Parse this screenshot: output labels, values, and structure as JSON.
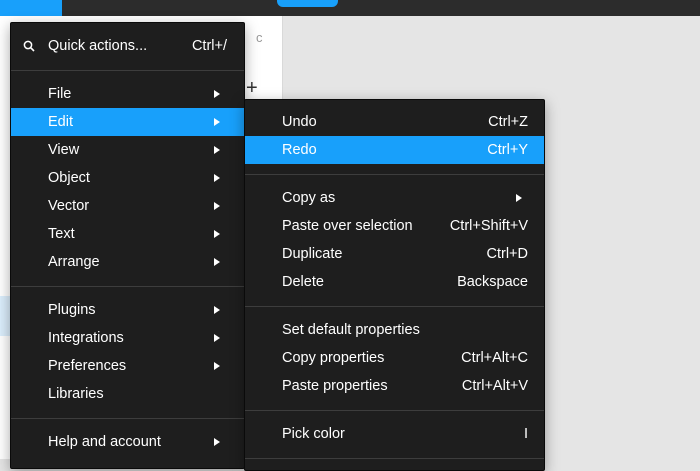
{
  "background": {
    "header_text": "c",
    "plus_label": "+"
  },
  "main_menu": {
    "quick_actions": {
      "label": "Quick actions...",
      "shortcut": "Ctrl+/"
    },
    "items": [
      {
        "label": "File"
      },
      {
        "label": "Edit"
      },
      {
        "label": "View"
      },
      {
        "label": "Object"
      },
      {
        "label": "Vector"
      },
      {
        "label": "Text"
      },
      {
        "label": "Arrange"
      },
      {
        "label": "Plugins"
      },
      {
        "label": "Integrations"
      },
      {
        "label": "Preferences"
      },
      {
        "label": "Libraries"
      },
      {
        "label": "Help and account"
      }
    ]
  },
  "edit_menu": {
    "items": [
      {
        "label": "Undo",
        "shortcut": "Ctrl+Z"
      },
      {
        "label": "Redo",
        "shortcut": "Ctrl+Y"
      },
      {
        "label": "Copy as"
      },
      {
        "label": "Paste over selection",
        "shortcut": "Ctrl+Shift+V"
      },
      {
        "label": "Duplicate",
        "shortcut": "Ctrl+D"
      },
      {
        "label": "Delete",
        "shortcut": "Backspace"
      },
      {
        "label": "Set default properties"
      },
      {
        "label": "Copy properties",
        "shortcut": "Ctrl+Alt+C"
      },
      {
        "label": "Paste properties",
        "shortcut": "Ctrl+Alt+V"
      },
      {
        "label": "Pick color",
        "shortcut": "I"
      }
    ]
  },
  "colors": {
    "accent": "#18a0fb",
    "menu_bg": "#1e1e1e",
    "separator": "#3d3d3d",
    "topbar": "#2c2c2c"
  }
}
